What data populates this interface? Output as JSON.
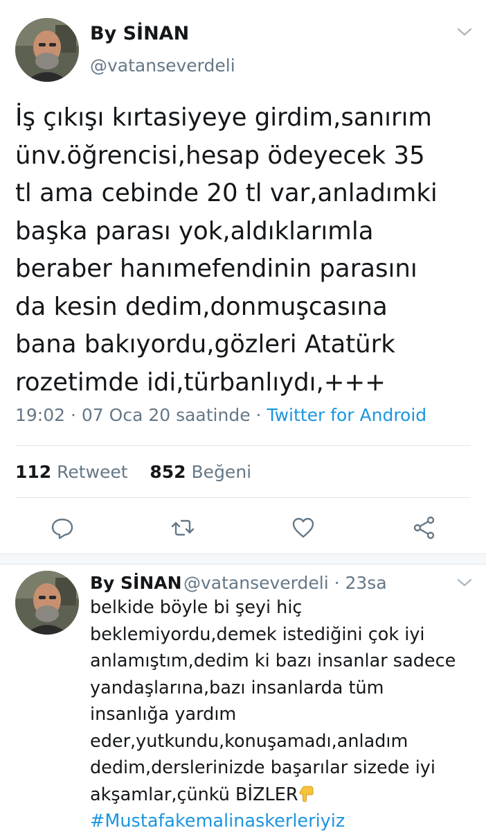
{
  "tweet": {
    "author_name": "By SİNAN",
    "author_handle": "@vatanseverdeli",
    "text": "İş çıkışı kırtasiyeye girdim,sanırım\nünv.öğrencisi,hesap ödeyecek 35\ntl ama cebinde 20 tl var,anladımki\nbaşka parası yok,aldıklarımla\nberaber hanımefendinin parasını\nda kesin dedim,donmuşcasına\nbana bakıyordu,gözleri Atatürk\nrozetimde idi,türbanlıydı,+++",
    "timestamp": "19:02 · 07 Oca 20 saatinde · ",
    "source": "Twitter for Android",
    "retweet_count": "112",
    "retweet_label": "Retweet",
    "like_count": "852",
    "like_label": "Beğeni"
  },
  "icons": {
    "more": "chevron-down-icon",
    "reply": "reply-icon",
    "retweet": "retweet-icon",
    "like": "heart-icon",
    "share": "share-icon",
    "emoji": "backhand-index-pointing-down"
  },
  "reply_tweet": {
    "author_name": "By SİNAN",
    "author_handle_time": "@vatanseverdeli · 23sa",
    "text": "belkide böyle bi şeyi hiç\nbeklemiyordu,demek istediğini çok iyi\nanlamıştım,dedim ki bazı insanlar sadece\nyandaşlarına,bazı insanlarda tüm\ninsanlığa yardım\neder,yutkundu,konuşamadı,anladım\ndedim,derslerinizde başarılar sizede iyi\nakşamlar,çünkü BİZLER",
    "hashtag": "#Mustafakemalinaskerleriyiz"
  },
  "colors": {
    "text": "#14171a",
    "secondary": "#657786",
    "link": "#1b95e0",
    "divider": "#e1e8ed",
    "separator_bg": "#f5f8fa"
  }
}
